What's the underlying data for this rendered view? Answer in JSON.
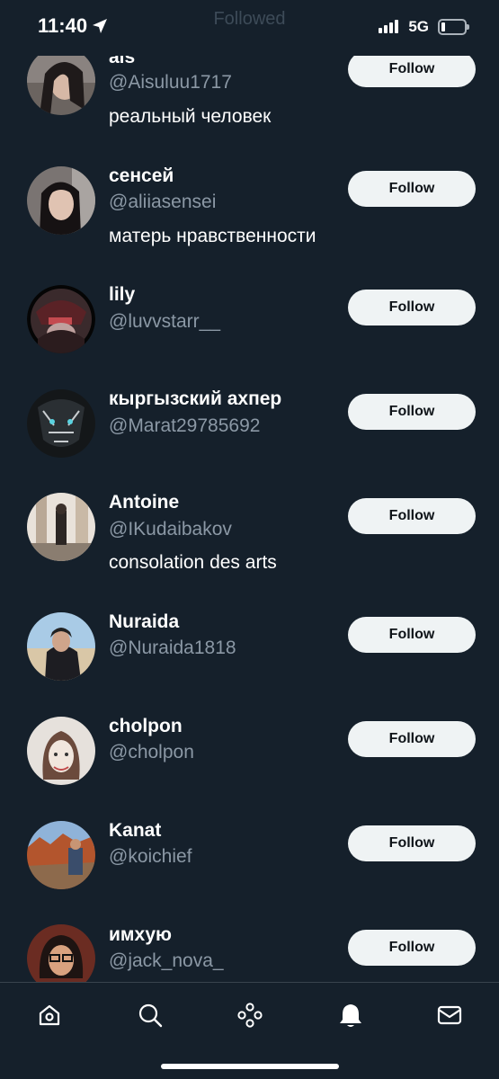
{
  "status": {
    "time": "11:40",
    "network": "5G"
  },
  "header": {
    "title": "Followed"
  },
  "follow_label": "Follow",
  "users": [
    {
      "name": "als",
      "handle": "@Aisuluu1717",
      "bio": "реальный человек"
    },
    {
      "name": "сенсей",
      "handle": "@aliiasensei",
      "bio": "матерь нравственности"
    },
    {
      "name": "lily",
      "handle": "@luvvstarr__",
      "bio": ""
    },
    {
      "name": "кыргызский ахпер",
      "handle": "@Marat29785692",
      "bio": ""
    },
    {
      "name": "Antoine",
      "handle": "@IKudaibakov",
      "bio": "consolation des arts"
    },
    {
      "name": "Nuraida",
      "handle": "@Nuraida1818",
      "bio": ""
    },
    {
      "name": "cholpon",
      "handle": "@cholpon",
      "bio": ""
    },
    {
      "name": "Kanat",
      "handle": "@koichief",
      "bio": ""
    },
    {
      "name": "имхую",
      "handle": "@jack_nova_",
      "bio": ""
    }
  ],
  "tab_bar": {
    "items": [
      "home-icon",
      "search-icon",
      "spaces-icon",
      "notifications-icon",
      "messages-icon"
    ]
  },
  "colors": {
    "background": "#15202b",
    "button_bg": "#eff3f4",
    "button_text": "#0f1419",
    "secondary_text": "#8b98a5",
    "divider": "#38444d"
  }
}
